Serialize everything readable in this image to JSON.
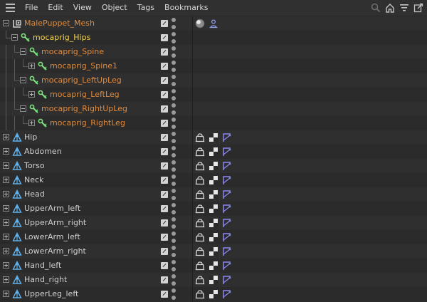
{
  "menu": {
    "items": [
      "File",
      "Edit",
      "View",
      "Object",
      "Tags",
      "Bookmarks"
    ]
  },
  "toolbar_icons": [
    "search-icon",
    "home-icon",
    "filter-icon",
    "new-window-icon"
  ],
  "colors": {
    "mocaprig_text": "#e0893a",
    "selected_text": "#f2d24a",
    "joint_text": "#cfcfcf",
    "joint_icon": "#5fb3f0",
    "null_icon": "#7ee27e",
    "ik_tag": "#7a7ae8"
  },
  "tree": {
    "rows": [
      {
        "label": "MalePuppet_Mesh",
        "depth": 0,
        "expander": "minus",
        "icon": "mesh-root-icon",
        "color": "orange",
        "tags": [
          "material-ball-icon",
          "person-tag-icon"
        ]
      },
      {
        "label": "mocaprig_Hips",
        "depth": 1,
        "expander": "minus",
        "icon": "null-bone-icon",
        "color": "yellow",
        "tags": []
      },
      {
        "label": "mocaprig_Spine",
        "depth": 2,
        "expander": "minus",
        "icon": "null-bone-icon",
        "color": "orange",
        "tags": []
      },
      {
        "label": "mocaprig_Spine1",
        "depth": 3,
        "expander": "plus",
        "icon": "null-bone-icon",
        "color": "orange",
        "tags": []
      },
      {
        "label": "mocaprig_LeftUpLeg",
        "depth": 2,
        "expander": "minus",
        "icon": "null-bone-icon",
        "color": "orange",
        "tags": []
      },
      {
        "label": "mocaprig_LeftLeg",
        "depth": 3,
        "expander": "plus",
        "icon": "null-bone-icon",
        "color": "orange",
        "tags": []
      },
      {
        "label": "mocaprig_RightUpLeg",
        "depth": 2,
        "expander": "minus",
        "icon": "null-bone-icon",
        "color": "orange",
        "tags": []
      },
      {
        "label": "mocaprig_RightLeg",
        "depth": 3,
        "expander": "plus",
        "icon": "null-bone-icon",
        "color": "orange",
        "tags": []
      },
      {
        "label": "Hip",
        "depth": 0,
        "expander": "plus",
        "icon": "joint-icon",
        "color": "gray",
        "tags": [
          "weight-tag-icon",
          "checker-tag-icon",
          "ik-tag-icon"
        ]
      },
      {
        "label": "Abdomen",
        "depth": 0,
        "expander": "plus",
        "icon": "joint-icon",
        "color": "gray",
        "tags": [
          "weight-tag-icon",
          "checker-tag-icon",
          "ik-tag-icon"
        ]
      },
      {
        "label": "Torso",
        "depth": 0,
        "expander": "plus",
        "icon": "joint-icon",
        "color": "gray",
        "tags": [
          "weight-tag-icon",
          "checker-tag-icon",
          "ik-tag-icon"
        ]
      },
      {
        "label": "Neck",
        "depth": 0,
        "expander": "plus",
        "icon": "joint-icon",
        "color": "gray",
        "tags": [
          "weight-tag-icon",
          "checker-tag-icon",
          "ik-tag-icon"
        ]
      },
      {
        "label": "Head",
        "depth": 0,
        "expander": "plus",
        "icon": "joint-icon",
        "color": "gray",
        "tags": [
          "weight-tag-icon",
          "checker-tag-icon",
          "ik-tag-icon"
        ]
      },
      {
        "label": "UpperArm_left",
        "depth": 0,
        "expander": "plus",
        "icon": "joint-icon",
        "color": "gray",
        "tags": [
          "weight-tag-icon",
          "checker-tag-icon",
          "ik-tag-icon"
        ]
      },
      {
        "label": "UpperArm_right",
        "depth": 0,
        "expander": "plus",
        "icon": "joint-icon",
        "color": "gray",
        "tags": [
          "weight-tag-icon",
          "checker-tag-icon",
          "ik-tag-icon"
        ]
      },
      {
        "label": "LowerArm_left",
        "depth": 0,
        "expander": "plus",
        "icon": "joint-icon",
        "color": "gray",
        "tags": [
          "weight-tag-icon",
          "checker-tag-icon",
          "ik-tag-icon"
        ]
      },
      {
        "label": "LowerArm_right",
        "depth": 0,
        "expander": "plus",
        "icon": "joint-icon",
        "color": "gray",
        "tags": [
          "weight-tag-icon",
          "checker-tag-icon",
          "ik-tag-icon"
        ]
      },
      {
        "label": "Hand_left",
        "depth": 0,
        "expander": "plus",
        "icon": "joint-icon",
        "color": "gray",
        "tags": [
          "weight-tag-icon",
          "checker-tag-icon",
          "ik-tag-icon"
        ]
      },
      {
        "label": "Hand_right",
        "depth": 0,
        "expander": "plus",
        "icon": "joint-icon",
        "color": "gray",
        "tags": [
          "weight-tag-icon",
          "checker-tag-icon",
          "ik-tag-icon"
        ]
      },
      {
        "label": "UpperLeg_left",
        "depth": 0,
        "expander": "plus",
        "icon": "joint-icon",
        "color": "gray",
        "tags": [
          "weight-tag-icon",
          "checker-tag-icon",
          "ik-tag-icon"
        ]
      }
    ]
  }
}
